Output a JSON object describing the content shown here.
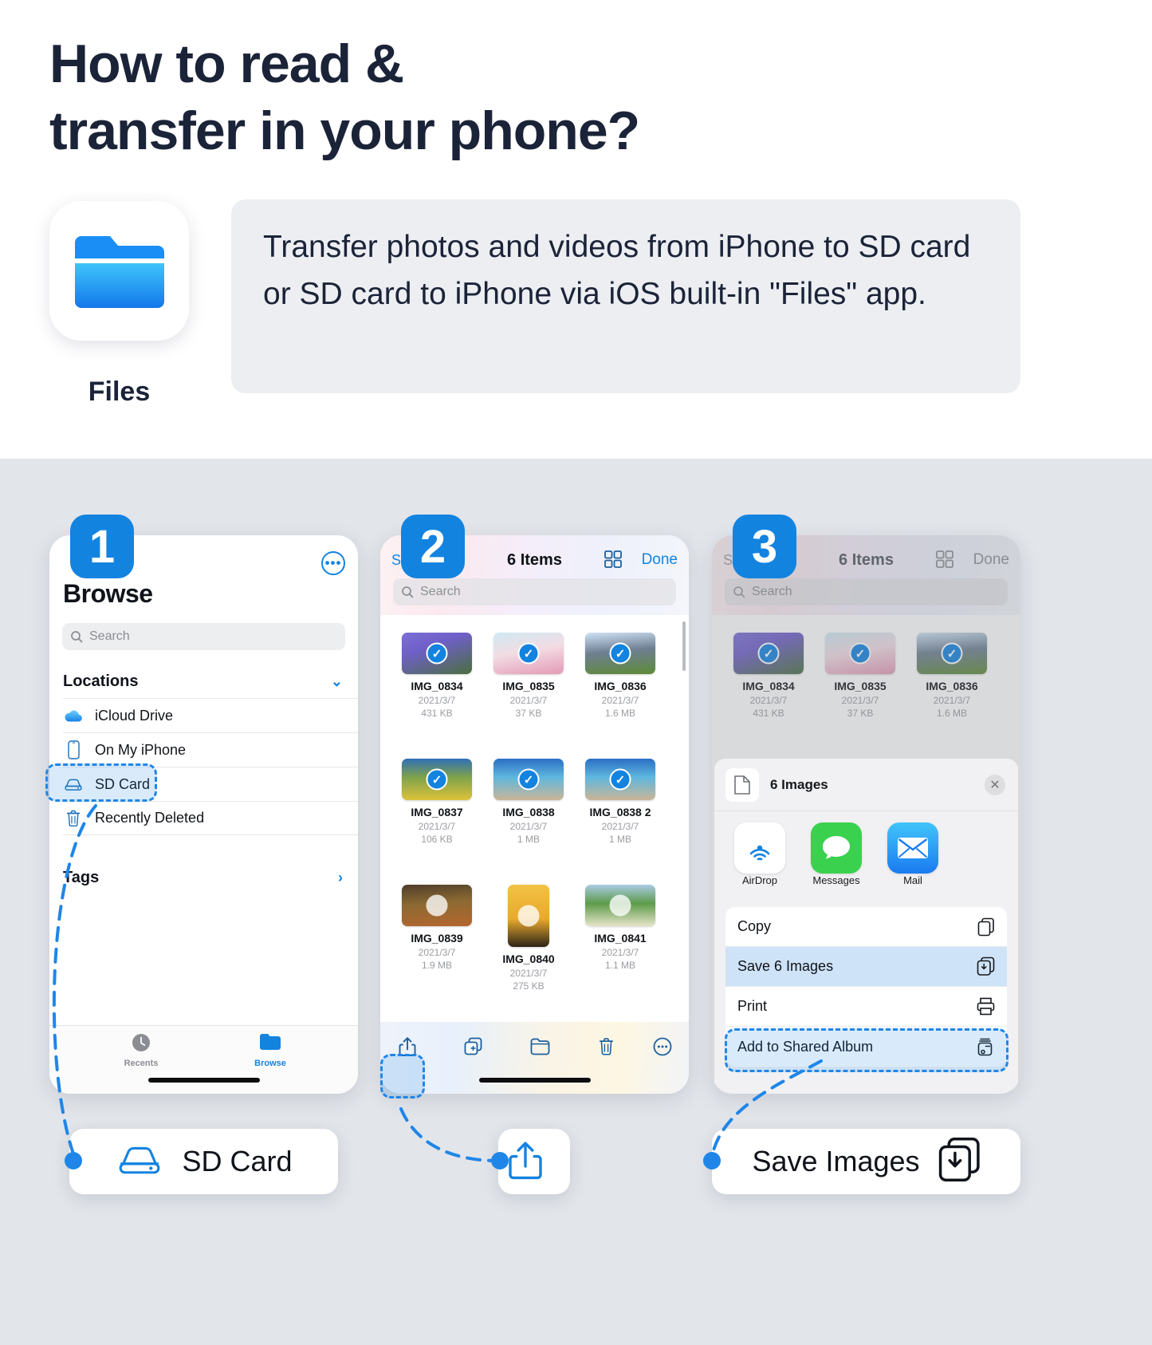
{
  "hero": {
    "title_line1": "How to read &",
    "title_line2": "transfer in your phone?",
    "app_icon_name": "files-app-icon",
    "app_label": "Files",
    "description": "Transfer photos and videos from iPhone to SD card or SD card to iPhone via iOS built-in \"Files\" app."
  },
  "steps": {
    "one": "1",
    "two": "2",
    "three": "3"
  },
  "phone1": {
    "more_icon": "•••",
    "title": "Browse",
    "search_placeholder": "Search",
    "sections": [
      {
        "label": "Locations",
        "chevron": "⌄"
      },
      {
        "label": "Tags",
        "chevron": "›"
      }
    ],
    "locations": [
      {
        "label": "iCloud Drive",
        "icon": "icloud-icon"
      },
      {
        "label": "On My iPhone",
        "icon": "iphone-icon"
      },
      {
        "label": "SD Card",
        "icon": "sdcard-icon"
      },
      {
        "label": "Recently Deleted",
        "icon": "trash-icon"
      }
    ],
    "tabs": [
      {
        "label": "Recents",
        "icon": "clock-icon"
      },
      {
        "label": "Browse",
        "icon": "folder-icon"
      }
    ]
  },
  "phone2": {
    "nav_back": "S",
    "nav_title": "6 Items",
    "nav_grid_icon": "grid-view-icon",
    "nav_done": "Done",
    "search_placeholder": "Search",
    "files": [
      {
        "name": "IMG_0834",
        "date": "2021/3/7",
        "size": "431 KB",
        "selected": true,
        "thumb": "lavender",
        "tall": false
      },
      {
        "name": "IMG_0835",
        "date": "2021/3/7",
        "size": "37 KB",
        "selected": true,
        "thumb": "pinkfield",
        "tall": false
      },
      {
        "name": "IMG_0836",
        "date": "2021/3/7",
        "size": "1.6 MB",
        "selected": true,
        "thumb": "mountain",
        "tall": false
      },
      {
        "name": "IMG_0837",
        "date": "2021/3/7",
        "size": "106 KB",
        "selected": true,
        "thumb": "hills",
        "tall": false
      },
      {
        "name": "IMG_0838",
        "date": "2021/3/7",
        "size": "1 MB",
        "selected": true,
        "thumb": "beach",
        "tall": false
      },
      {
        "name": "IMG_0838 2",
        "date": "2021/3/7",
        "size": "1 MB",
        "selected": true,
        "thumb": "beach2",
        "tall": false
      },
      {
        "name": "IMG_0839",
        "date": "2021/3/7",
        "size": "1.9 MB",
        "selected": false,
        "thumb": "autumn",
        "tall": false
      },
      {
        "name": "IMG_0840",
        "date": "2021/3/7",
        "size": "275 KB",
        "selected": false,
        "thumb": "sunset",
        "tall": true
      },
      {
        "name": "IMG_0841",
        "date": "2021/3/7",
        "size": "1.1 MB",
        "selected": false,
        "thumb": "windmill",
        "tall": false
      }
    ],
    "toolbar": [
      {
        "icon": "share-icon"
      },
      {
        "icon": "duplicate-icon"
      },
      {
        "icon": "folder-icon"
      },
      {
        "icon": "trash-icon"
      },
      {
        "icon": "more-icon"
      }
    ]
  },
  "phone3": {
    "nav_back": "S",
    "nav_title": "6 Items",
    "nav_grid_icon": "grid-view-icon",
    "nav_done": "Done",
    "search_placeholder": "Search",
    "sheet": {
      "file_icon": "document-icon",
      "title": "6 Images",
      "close_icon": "✕",
      "apps": [
        {
          "name": "AirDrop",
          "icon": "airdrop-icon"
        },
        {
          "name": "Messages",
          "icon": "messages-icon"
        },
        {
          "name": "Mail",
          "icon": "mail-icon"
        }
      ],
      "actions": [
        {
          "label": "Copy",
          "icon": "copy-icon",
          "selected": false
        },
        {
          "label": "Save 6 Images",
          "icon": "save-images-icon",
          "selected": true
        },
        {
          "label": "Print",
          "icon": "printer-icon",
          "selected": false
        },
        {
          "label": "Add to Shared Album",
          "icon": "shared-album-icon",
          "selected": false
        }
      ]
    }
  },
  "callouts": [
    {
      "label": "SD Card",
      "icon": "sdcard-icon"
    },
    {
      "label": "",
      "icon": "share-icon"
    },
    {
      "label": "Save Images",
      "icon": "save-images-icon"
    }
  ],
  "colors": {
    "accent": "#1383e0",
    "highlight_fill": "#cfe3f8",
    "stage_bg": "#e2e5ea",
    "text_dark": "#1b2338"
  }
}
